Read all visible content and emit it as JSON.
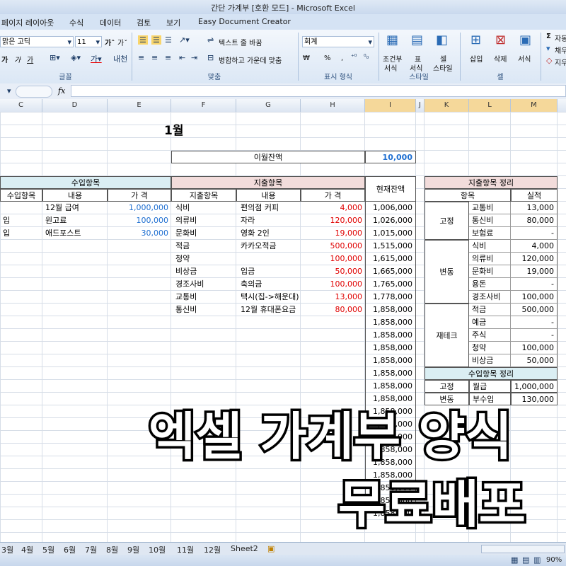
{
  "window": {
    "title": "간단 가계부  [호환 모드] - Microsoft Excel"
  },
  "tabs": [
    "페이지 레이아웃",
    "수식",
    "데이터",
    "검토",
    "보기",
    "Easy Document Creator"
  ],
  "ribbon": {
    "font_name": "맑은 고딕",
    "font_size": "11",
    "wrap_text": "텍스트 줄 바꿈",
    "merge_center": "병합하고 가운데 맞춤",
    "number_format": "회계",
    "currency": "₩",
    "percent": "%",
    "comma": ",",
    "cond_format": "조건부",
    "cond_format2": "서식",
    "table": "표",
    "table2": "서식",
    "cell_style": "셀",
    "cell_style2": "스타일",
    "insert": "삽입",
    "delete": "삭제",
    "format": "서식",
    "autosum": "자동",
    "fill": "채우",
    "clear": "지우",
    "group_font": "글꼴",
    "group_align": "맞춤",
    "group_number": "표시 형식",
    "group_style": "스타일",
    "group_cell": "셀"
  },
  "formula_bar": {
    "fx": "fx"
  },
  "columns": [
    "C",
    "D",
    "E",
    "F",
    "G",
    "H",
    "I",
    "J",
    "K",
    "L",
    "M"
  ],
  "sheet": {
    "month_title": "1월",
    "prev_balance_label": "이월잔액",
    "prev_balance_value": "10,000",
    "income_header": "수입항목",
    "income_cols": [
      "수입항목",
      "내용",
      "가 격"
    ],
    "income_rows": [
      {
        "cat": "",
        "desc": "12월 급여",
        "amount": "1,000,000"
      },
      {
        "cat": "입",
        "desc": "원고료",
        "amount": "100,000"
      },
      {
        "cat": "입",
        "desc": "애드포스트",
        "amount": "30,000"
      }
    ],
    "expense_header": "지출항목",
    "expense_cols": [
      "지출항목",
      "내용",
      "가 격"
    ],
    "expense_rows": [
      {
        "cat": "식비",
        "desc": "편의점 커피",
        "amount": "4,000"
      },
      {
        "cat": "의류비",
        "desc": "자라",
        "amount": "120,000"
      },
      {
        "cat": "문화비",
        "desc": "영화 2인",
        "amount": "19,000"
      },
      {
        "cat": "적금",
        "desc": "카카오적금",
        "amount": "500,000"
      },
      {
        "cat": "청약",
        "desc": "",
        "amount": "100,000"
      },
      {
        "cat": "비상금",
        "desc": "입금",
        "amount": "50,000"
      },
      {
        "cat": "경조사비",
        "desc": "축의금",
        "amount": "100,000"
      },
      {
        "cat": "교통비",
        "desc": "택시(집->해운대)",
        "amount": "13,000"
      },
      {
        "cat": "통신비",
        "desc": "12월 휴대폰요금",
        "amount": "80,000"
      }
    ],
    "balance_header": "현재잔액",
    "balances": [
      "1,006,000",
      "1,026,000",
      "1,015,000",
      "1,515,000",
      "1,615,000",
      "1,665,000",
      "1,765,000",
      "1,778,000",
      "1,858,000",
      "1,858,000",
      "1,858,000",
      "1,858,000",
      "1,858,000",
      "1,858,000",
      "1,858,000",
      "1,858,000",
      "1,858,000",
      "1,858,000",
      "1,858,000",
      "1,858,000",
      "1,858,000",
      "1,858,000",
      "1,858,000",
      "1,858,000",
      "1,858,000"
    ],
    "summary_header": "지출항목 정리",
    "summary_cols": [
      "항목",
      "실적"
    ],
    "summary_groups": [
      {
        "group": "고정",
        "items": [
          [
            "교통비",
            "13,000"
          ],
          [
            "통신비",
            "80,000"
          ],
          [
            "보험료",
            "-"
          ]
        ]
      },
      {
        "group": "변동",
        "items": [
          [
            "식비",
            "4,000"
          ],
          [
            "의류비",
            "120,000"
          ],
          [
            "문화비",
            "19,000"
          ],
          [
            "용돈",
            "-"
          ],
          [
            "경조사비",
            "100,000"
          ]
        ]
      },
      {
        "group": "재테크",
        "items": [
          [
            "적금",
            "500,000"
          ],
          [
            "예금",
            "-"
          ],
          [
            "주식",
            "-"
          ],
          [
            "청약",
            "100,000"
          ],
          [
            "비상금",
            "50,000"
          ]
        ]
      }
    ],
    "income_summary_header": "수입항목 정리",
    "income_summary": [
      {
        "group": "고정",
        "item": "월급",
        "value": "1,000,000"
      },
      {
        "group": "변동",
        "item": "부수입",
        "value": "130,000"
      }
    ]
  },
  "sheet_tabs": [
    "3월",
    "4월",
    "5월",
    "6월",
    "7월",
    "8월",
    "9월",
    "10월",
    "11월",
    "12월",
    "Sheet2"
  ],
  "status": {
    "zoom": "90%"
  },
  "overlay": {
    "line1": "엑셀 가계부 양식",
    "line2": "무료배포"
  }
}
